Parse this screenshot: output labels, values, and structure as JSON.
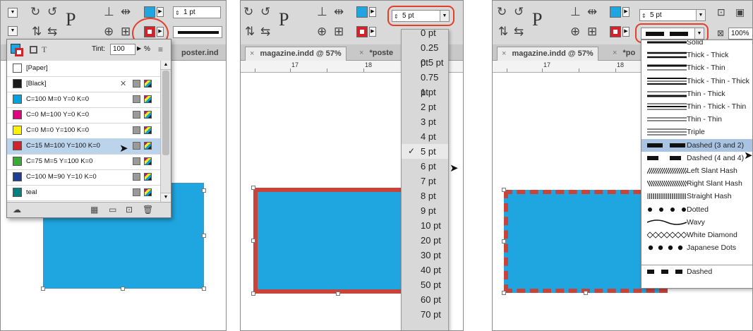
{
  "colors": {
    "highlight": "#e2402a",
    "frame_fill": "#1fa6e0",
    "frame_stroke": "#c8433a",
    "ui_gray": "#d9d9d9",
    "selection": "#bcd3ec"
  },
  "panel1": {
    "stroke_weight_value": "1 pt",
    "tint_label": "Tint:",
    "tint_value": "100",
    "tint_unit": "%",
    "tab_label": "poster.ind",
    "swatches": [
      {
        "name": "[Paper]",
        "color": "#ffffff"
      },
      {
        "name": "[Black]",
        "color": "#1a1a1a"
      },
      {
        "name": "C=100 M=0 Y=0 K=0",
        "color": "#00a3e0"
      },
      {
        "name": "C=0 M=100 Y=0 K=0",
        "color": "#e4007c"
      },
      {
        "name": "C=0 M=0 Y=100 K=0",
        "color": "#fff200"
      },
      {
        "name": "C=15 M=100 Y=100 K=0",
        "color": "#d2232a"
      },
      {
        "name": "C=75 M=5 Y=100 K=0",
        "color": "#3aaa35"
      },
      {
        "name": "C=100 M=90 Y=10 K=0",
        "color": "#1f3e92"
      },
      {
        "name": "teal",
        "color": "#008080"
      }
    ],
    "selected_swatch_index": 5
  },
  "panel2": {
    "weight_value": "5 pt",
    "tab1": "magazine.indd @ 57%",
    "tab2": "*poste",
    "ruler_labels": [
      "17",
      "18"
    ],
    "weights": [
      "0 pt",
      "0.25 pt",
      "0.5 pt",
      "0.75 pt",
      "1 pt",
      "2 pt",
      "3 pt",
      "4 pt",
      "5 pt",
      "6 pt",
      "7 pt",
      "8 pt",
      "9 pt",
      "10 pt",
      "20 pt",
      "30 pt",
      "40 pt",
      "50 pt",
      "60 pt",
      "70 pt"
    ],
    "checked_weight_index": 8,
    "check_glyph": "✓"
  },
  "panel3": {
    "weight_value": "5 pt",
    "zoom_value": "100%",
    "tab1": "magazine.indd @ 57%",
    "tab2": "*po",
    "ruler_labels": [
      "17",
      "18"
    ],
    "stroke_types": [
      "Solid",
      "Thick - Thick",
      "Thick - Thin",
      "Thick - Thin - Thick",
      "Thin - Thick",
      "Thin - Thick - Thin",
      "Thin - Thin",
      "Triple",
      "Dashed (3 and 2)",
      "Dashed (4 and 4)",
      "Left Slant Hash",
      "Right Slant Hash",
      "Straight Hash",
      "Dotted",
      "Wavy",
      "White Diamond",
      "Japanese Dots",
      "Dashed"
    ],
    "selected_type_index": 8
  },
  "icons": [
    "rotate-icon",
    "flip-icon",
    "type-on-path-icon",
    "align-icon",
    "distribute-icon",
    "fill-swatch-icon",
    "stroke-swatch-icon",
    "new-swatch-icon",
    "folder-icon",
    "delete-icon",
    "cc-library-icon",
    "cursor-icon"
  ]
}
